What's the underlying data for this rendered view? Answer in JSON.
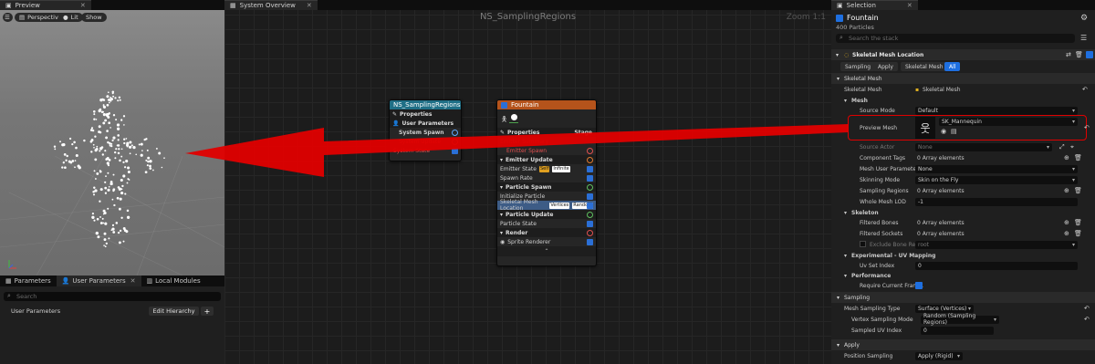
{
  "left": {
    "tab_title": "Preview",
    "viewport_buttons": {
      "perspective": "Perspective",
      "lit": "Lit",
      "show": "Show"
    },
    "tabs": [
      {
        "label": "Parameters"
      },
      {
        "label": "User Parameters"
      },
      {
        "label": "Local Modules"
      }
    ],
    "search_placeholder": "Search",
    "user_parameters_label": "User Parameters",
    "edit_hierarchy": "Edit Hierarchy",
    "add": "+"
  },
  "graph": {
    "tab_title": "System Overview",
    "title": "NS_SamplingRegions",
    "zoom": "Zoom 1:1",
    "system_node": {
      "header": "NS_SamplingRegions",
      "rows": [
        "Properties",
        "User Parameters",
        "System Spawn",
        "System Update",
        "System State"
      ]
    },
    "emitter_node": {
      "header": "Fountain",
      "properties": "Properties",
      "stage": "Stage",
      "emitter_summary": "Emitter Summary",
      "emitter_spawn": "Emitter Spawn",
      "emitter_update": "Emitter Update",
      "emitter_state": "Emitter State",
      "self": "Self",
      "infinite": "Infinite",
      "spawn_rate": "Spawn Rate",
      "particle_spawn": "Particle Spawn",
      "initialize_particle": "Initialize Particle",
      "skeletal_mesh_location": "Skeletal Mesh Location",
      "vertices": "Vertices",
      "random": "Random",
      "particle_update": "Particle Update",
      "particle_state": "Particle State",
      "render": "Render",
      "sprite_renderer": "Sprite Renderer"
    }
  },
  "right": {
    "tab_title": "Selection",
    "emitter_name": "Fountain",
    "particle_count": "400 Particles",
    "search_placeholder": "Search the stack",
    "module_title": "Skeletal Mesh Location",
    "tabs": [
      "Sampling",
      "Apply",
      "Skeletal Mesh",
      "All"
    ],
    "active_tab": "All",
    "section_skeletal_mesh": "Skeletal Mesh",
    "skeletal_mesh_label": "Skeletal Mesh",
    "skeletal_mesh_value": "Skeletal Mesh",
    "mesh_group": "Mesh",
    "source_mode_label": "Source Mode",
    "source_mode_value": "Default",
    "preview_mesh_label": "Preview Mesh",
    "preview_mesh_value": "SK_Mannequin",
    "source_actor_label": "Source Actor",
    "source_actor_value": "None",
    "component_tags_label": "Component Tags",
    "component_tags_value": "0 Array elements",
    "mesh_user_param_label": "Mesh User Parameter",
    "mesh_user_param_value": "None",
    "skinning_mode_label": "Skinning Mode",
    "skinning_mode_value": "Skin on the Fly",
    "sampling_regions_label": "Sampling Regions",
    "sampling_regions_value": "0 Array elements",
    "whole_mesh_lod_label": "Whole Mesh LOD",
    "whole_mesh_lod_value": "-1",
    "skeleton_group": "Skeleton",
    "filtered_bones_label": "Filtered Bones",
    "filtered_bones_value": "0 Array elements",
    "filtered_sockets_label": "Filtered Sockets",
    "filtered_sockets_value": "0 Array elements",
    "exclude_bone_label": "Exclude Bone Re...",
    "exclude_bone_value": "root",
    "experimental_group": "Experimental - UV Mapping",
    "uv_set_label": "Uv Set Index",
    "uv_set_value": "0",
    "performance_group": "Performance",
    "require_frame_label": "Require Current Fram...",
    "section_sampling": "Sampling",
    "mesh_sampling_type_label": "Mesh Sampling Type",
    "mesh_sampling_type_value": "Surface (Vertices)",
    "vertex_sampling_mode_label": "Vertex Sampling Mode",
    "vertex_sampling_mode_value": "Random (Sampling Regions)",
    "sampled_uv_label": "Sampled UV Index",
    "sampled_uv_value": "0",
    "section_apply": "Apply",
    "position_sampling_label": "Position Sampling",
    "position_sampling_value": "Apply (Rigid)"
  },
  "colors": {
    "accent_blue": "#1e6fe0",
    "annotation_red": "#e00000",
    "system_header": "#1f6f86",
    "emitter_header": "#b5531b"
  }
}
